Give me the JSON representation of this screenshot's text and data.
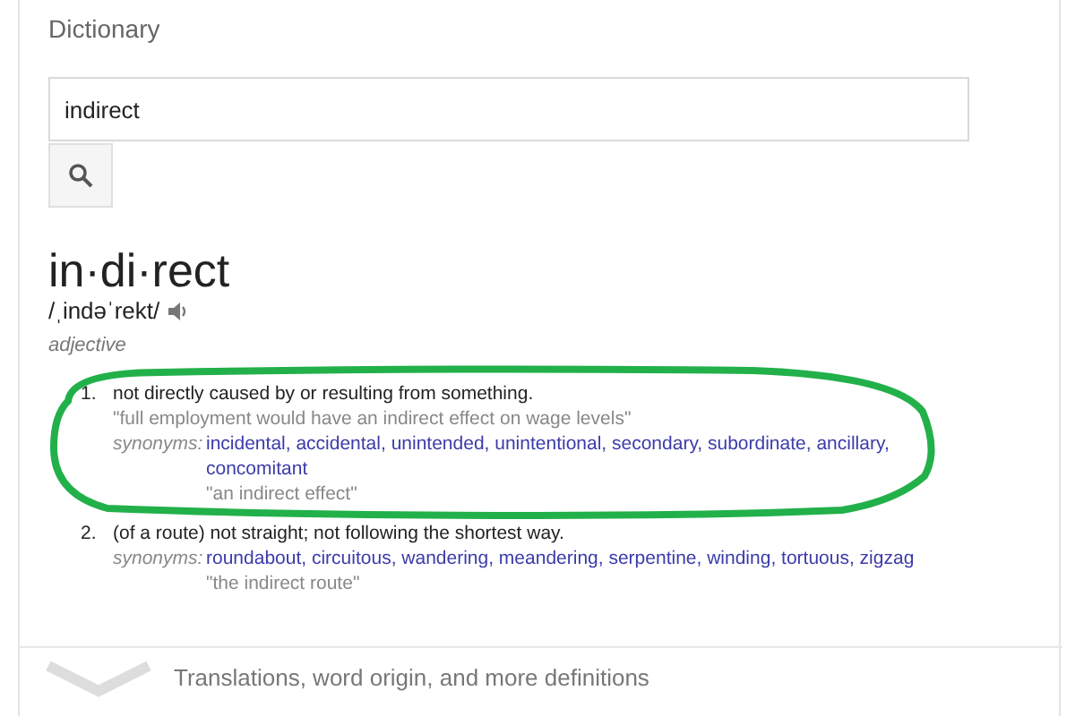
{
  "card": {
    "title": "Dictionary"
  },
  "search": {
    "value": "indirect"
  },
  "entry": {
    "headword": "in·di·rect",
    "pronunciation": "/ˌindəˈrekt/",
    "part_of_speech": "adjective",
    "senses": [
      {
        "number": "1.",
        "definition": "not directly caused by or resulting from something.",
        "example": "\"full employment would have an indirect effect on wage levels\"",
        "synonyms_label": "synonyms:",
        "synonyms": "incidental, accidental, unintended, unintentional, secondary, subordinate, ancillary, concomitant",
        "synonym_example": "\"an indirect effect\""
      },
      {
        "number": "2.",
        "qualifier": "(of a route)",
        "definition": "not straight; not following the shortest way.",
        "synonyms_label": "synonyms:",
        "synonyms": "roundabout, circuitous, wandering, meandering, serpentine, winding, tortuous, zigzag",
        "synonym_example": "\"the indirect route\""
      }
    ]
  },
  "more": {
    "label": "Translations, word origin, and more definitions"
  }
}
